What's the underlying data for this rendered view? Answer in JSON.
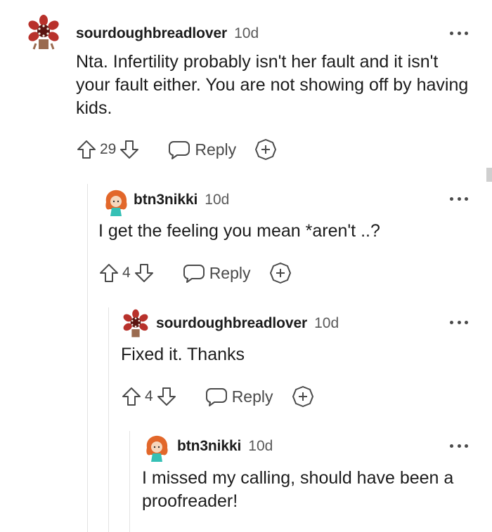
{
  "comments": [
    {
      "username": "sourdoughbreadlover",
      "time": "10d",
      "body": "Nta. Infertility probably isn't her fault and it isn't your fault either. You are not showing off by having kids.",
      "score": "29",
      "reply_label": "Reply",
      "avatar_icon": "demogorgon-avatar-icon"
    },
    {
      "username": "btn3nikki",
      "time": "10d",
      "body": "I get the feeling you mean *aren't ..?",
      "score": "4",
      "reply_label": "Reply",
      "avatar_icon": "redhead-girl-avatar-icon"
    },
    {
      "username": "sourdoughbreadlover",
      "time": "10d",
      "body": "Fixed it. Thanks",
      "score": "4",
      "reply_label": "Reply",
      "avatar_icon": "demogorgon-avatar-icon"
    },
    {
      "username": "btn3nikki",
      "time": "10d",
      "body": "I missed my calling, should have been a proofreader!",
      "avatar_icon": "redhead-girl-avatar-icon"
    }
  ],
  "colors": {
    "text": "#1c1c1c",
    "muted": "#5a5a5a",
    "icon": "#4a4a4a",
    "thread_line": "#e3e3e3",
    "avatar_red": "#b8312b",
    "avatar_hair": "#e2672a",
    "avatar_shirt": "#35c0b5"
  }
}
